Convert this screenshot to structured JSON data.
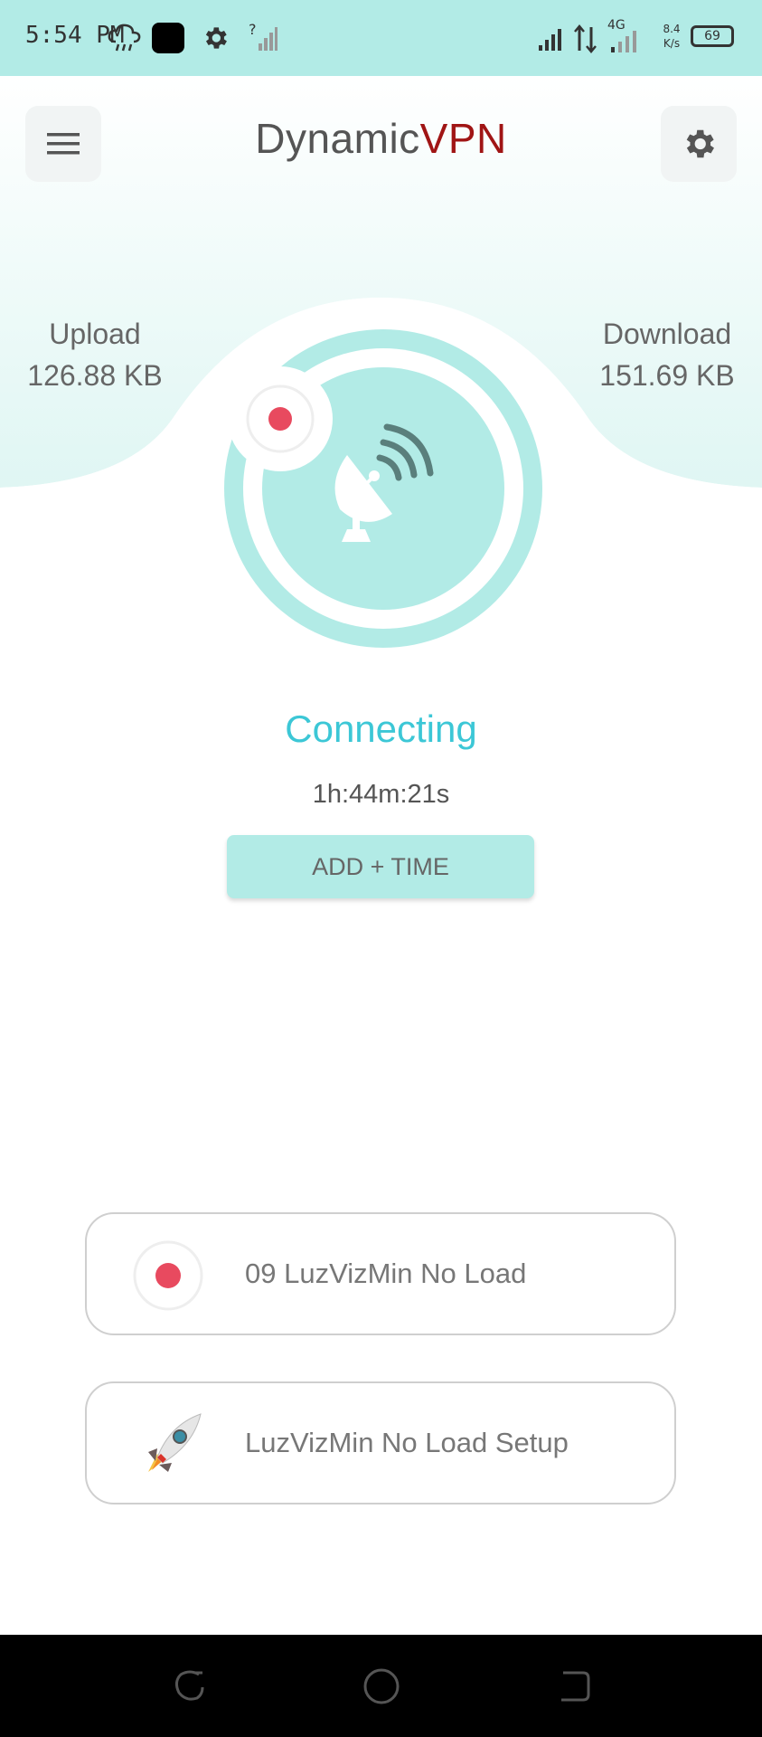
{
  "status_bar": {
    "time": "5:54 PM",
    "network_type": "4G",
    "speed_value": "8.4",
    "speed_unit": "K/s",
    "battery": "69"
  },
  "header": {
    "title_main": "Dynamic",
    "title_accent": "VPN",
    "menu_icon": "hamburger-menu-icon",
    "settings_icon": "gear-icon"
  },
  "stats": {
    "upload_label": "Upload",
    "upload_value": "126.88 KB",
    "download_label": "Download",
    "download_value": "151.69 KB"
  },
  "connection": {
    "status": "Connecting",
    "elapsed": "1h:44m:21s",
    "add_time_label": "ADD + TIME"
  },
  "servers": [
    {
      "label": "09 LuzVizMin No Load",
      "icon": "red-dot-icon"
    },
    {
      "label": "LuzVizMin No Load Setup",
      "icon": "rocket-icon"
    }
  ],
  "colors": {
    "accent_teal": "#b2ebe6",
    "status_text": "#3cc7d6",
    "brand_red": "#a01515",
    "indicator_red": "#e84a5f"
  }
}
